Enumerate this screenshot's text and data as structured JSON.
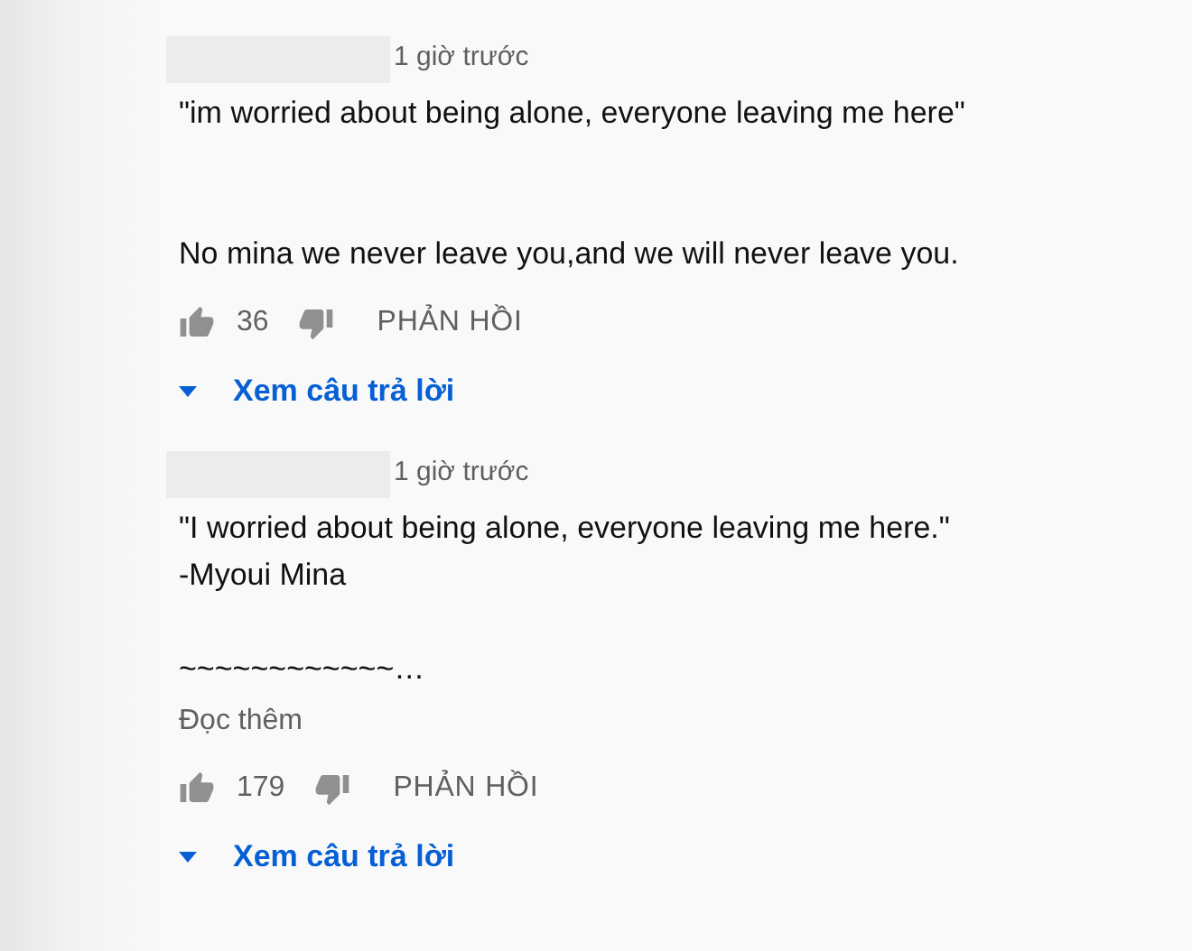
{
  "comments": [
    {
      "time": "1 giờ trước",
      "body": "\"im worried about being alone, everyone leaving me here\"\n\n\nNo mina we never leave you,and we will never leave you.",
      "likes": "36",
      "reply_label": "PHẢN HỒI",
      "view_replies": "Xem câu trả lời"
    },
    {
      "time": "1 giờ trước",
      "body": "\"I worried about being alone, everyone leaving me here.\"\n-Myoui Mina\n\n~~~~~~~~~~~~…",
      "read_more": "Đọc thêm",
      "likes": "179",
      "reply_label": "PHẢN HỒI",
      "view_replies": "Xem câu trả lời"
    }
  ]
}
